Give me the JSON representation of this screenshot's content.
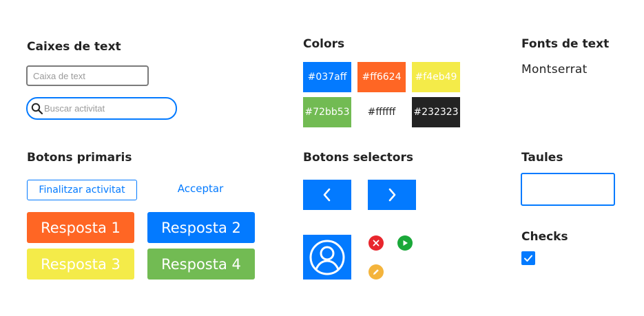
{
  "sections": {
    "text_boxes": "Caixes de text",
    "colors": "Colors",
    "fonts": "Fonts de text",
    "primary_buttons": "Botons primaris",
    "selector_buttons": "Botons selectors",
    "tables": "Taules",
    "checks": "Checks"
  },
  "text_boxes": {
    "textbox_placeholder": "Caixa de text",
    "search_placeholder": "Buscar activitat",
    "search_icon": "search-icon"
  },
  "colors": [
    {
      "label": "#037aff",
      "hex": "#037aff",
      "text_color": "#ffffff"
    },
    {
      "label": "#ff6624",
      "hex": "#ff6624",
      "text_color": "#ffffff"
    },
    {
      "label": "#f4eb49",
      "hex": "#f4eb49",
      "text_color": "#ffffff"
    },
    {
      "label": "#72bb53",
      "hex": "#72bb53",
      "text_color": "#ffffff"
    },
    {
      "label": "#ffffff",
      "hex": "#ffffff",
      "text_color": "#232323"
    },
    {
      "label": "#232323",
      "hex": "#232323",
      "text_color": "#ffffff"
    }
  ],
  "fonts": {
    "sample": "Montserrat"
  },
  "primary_buttons": {
    "finish_label": "Finalitzar activitat",
    "accept_label": "Acceptar",
    "answers": [
      {
        "label": "Resposta 1",
        "color": "#ff6624"
      },
      {
        "label": "Resposta 2",
        "color": "#037aff"
      },
      {
        "label": "Resposta 3",
        "color": "#f4eb49"
      },
      {
        "label": "Resposta 4",
        "color": "#72bb53"
      }
    ]
  },
  "selector_buttons": {
    "prev_icon": "chevron-left-icon",
    "next_icon": "chevron-right-icon",
    "avatar_icon": "user-avatar-icon",
    "close_icon": {
      "name": "close-icon",
      "color": "#e8262d"
    },
    "play_icon": {
      "name": "play-icon",
      "color": "#1aa839"
    },
    "edit_icon": {
      "name": "pencil-icon",
      "color": "#f4b43c"
    }
  },
  "checks": {
    "checked": true,
    "icon": "check-icon"
  }
}
